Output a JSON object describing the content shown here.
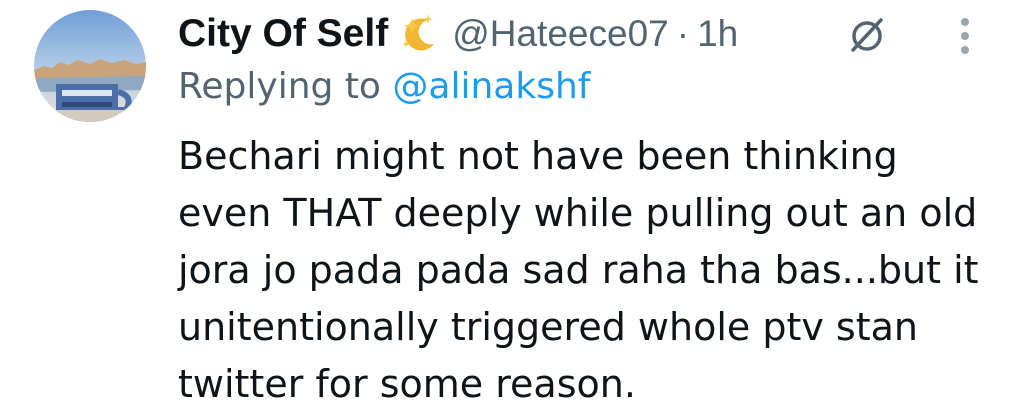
{
  "tweet": {
    "author": {
      "display_name": "City Of Self",
      "handle": "@Hateece07",
      "badge_icon": "sparkles-moon-icon"
    },
    "separator": "·",
    "time": "1h",
    "reply_prefix": "Replying to",
    "reply_to": "@alinakshf",
    "text_lines": [
      "Bechari might not have been thinking",
      "even THAT deeply while pulling out an old",
      "jora jo pada pada sad raha tha bas...but it",
      "unitentionally triggered whole ptv stan",
      "twitter for some reason."
    ]
  },
  "icons": {
    "grok": "grok-icon",
    "more": "more-options-icon"
  },
  "colors": {
    "text": "#0f1419",
    "secondary": "#536471",
    "link": "#1d9bf0"
  }
}
